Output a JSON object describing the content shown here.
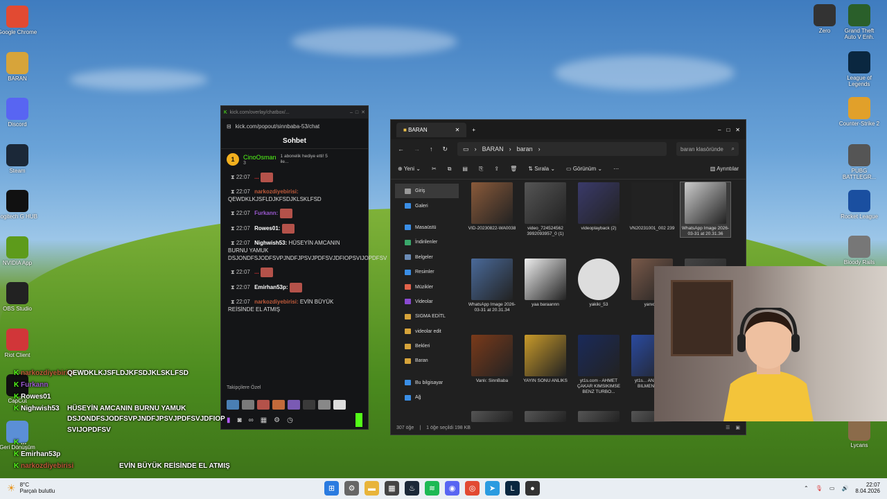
{
  "desktop_left": [
    {
      "name": "google-chrome",
      "label": "Google Chrome",
      "color": "#e24a32"
    },
    {
      "name": "baran-folder",
      "label": "BARAN",
      "color": "#d7a43a"
    },
    {
      "name": "discord",
      "label": "Discord",
      "color": "#5865f2"
    },
    {
      "name": "steam",
      "label": "Steam",
      "color": "#1b2838"
    },
    {
      "name": "logitech-g-hub",
      "label": "Logitech G HUB",
      "color": "#111"
    },
    {
      "name": "nvidia-app",
      "label": "NVIDIA App",
      "color": "#5d9b1b"
    },
    {
      "name": "obs-studio",
      "label": "OBS Studio",
      "color": "#222"
    },
    {
      "name": "riot-client",
      "label": "Riot Client",
      "color": "#d13639"
    },
    {
      "name": "capcut",
      "label": "CapCut",
      "color": "#111"
    },
    {
      "name": "recycle-bin",
      "label": "Geri Dönüşüm",
      "color": "#5b8fd6"
    }
  ],
  "desktop_right": [
    {
      "name": "zero",
      "label": "Zero",
      "color": "#333"
    },
    {
      "name": "gta",
      "label": "Grand Theft Auto V Enh.",
      "color": "#2a5f2a"
    },
    {
      "name": "league",
      "label": "League of Legends",
      "color": "#0a2740"
    },
    {
      "name": "counter-strike",
      "label": "Counter-Strike 2",
      "color": "#e1a02a"
    },
    {
      "name": "pubg",
      "label": "PUBG BATTLEGR...",
      "color": "#555"
    },
    {
      "name": "rocket-league",
      "label": "Rocket League",
      "color": "#1a4fa0"
    },
    {
      "name": "blackmail",
      "label": "Bloody Rails",
      "color": "#777"
    },
    {
      "name": "user",
      "label": "Lycans",
      "color": "#8b6b4a"
    }
  ],
  "kick": {
    "titlebar": "kick.com/overlay/chatbox/...",
    "url": "kick.com/popout/sinnbaba-53/chat",
    "header": "Sohbet",
    "pinned_user": "CinoOsman",
    "pinned_count": "3",
    "pinned_text": "1 abonelik hediye etti! 5 ile...",
    "messages": [
      {
        "time": "22:07",
        "user": "...",
        "text": ""
      },
      {
        "time": "22:07",
        "user": "narkozdiyebirisi:",
        "text": "QEWDKLKJSFLDJKFSDJKLSKLFSD"
      },
      {
        "time": "22:07",
        "user": "Furkann:",
        "text": ""
      },
      {
        "time": "22:07",
        "user": "Rowes01:",
        "text": ""
      },
      {
        "time": "22:07",
        "user": "Nighwish53:",
        "text": "HÜSEYİN AMCANIN BURNU YAMUK DSJONDFSJODFSVPJNDFJPSVJPDFSVJDFIOPSVIJOPDFSV"
      },
      {
        "time": "22:07",
        "user": "...",
        "text": ""
      },
      {
        "time": "22:07",
        "user": "Emirhan53p:",
        "text": ""
      },
      {
        "time": "22:07",
        "user": "narkozdiyebirisi:",
        "text": "EVİN BÜYÜK REİSİNDE EL ATMIŞ"
      }
    ],
    "footer": "Takipçilere Özel"
  },
  "explorer": {
    "tab": "BARAN",
    "breadcrumb": [
      "BARAN",
      "baran"
    ],
    "search": "baran klasöründe",
    "tools": [
      "Yeni",
      "Sırala",
      "Görünüm",
      "Ayrıntılar"
    ],
    "sidebar": [
      {
        "label": "Giriş",
        "color": "#999"
      },
      {
        "label": "Galeri",
        "color": "#3a8ee6"
      },
      {
        "label": "Masaüstü",
        "color": "#3a8ee6"
      },
      {
        "label": "İndirilenler",
        "color": "#3aa86b"
      },
      {
        "label": "Belgeler",
        "color": "#6b8cb6"
      },
      {
        "label": "Resimler",
        "color": "#3a8ee6"
      },
      {
        "label": "Müzikler",
        "color": "#e1624a"
      },
      {
        "label": "Videolar",
        "color": "#8a4ad1"
      },
      {
        "label": "SIGMA EDİTL",
        "color": "#d7a43a"
      },
      {
        "label": "videolar edit",
        "color": "#d7a43a"
      },
      {
        "label": "Bekleri",
        "color": "#d7a43a"
      },
      {
        "label": "Baran",
        "color": "#d7a43a"
      },
      {
        "label": "Bu bilgisayar",
        "color": "#3a8ee6"
      },
      {
        "label": "Ağ",
        "color": "#3a8ee6"
      }
    ],
    "files": [
      "VID-20230822-WA0038",
      "video_724524562 3992093957_0 (1)",
      "videoplayback (2)",
      "VN20231001_002 239",
      "WhatsApp Image 2026-03-31 at 20.31.36",
      "WhatsApp Image 2026-03-31 at 20.31.34",
      "yaa baraannn",
      "yakiki_53",
      "yanıcı...",
      "",
      "Vanlı: SinnBaba",
      "YAYIN SONU ANLIKS",
      "yt1s.com - AHMET ÇAKAR KIMSIKIMSE BENZ TURBO...",
      "yt1s... ANANLA... BILMEN... SEI",
      ""
    ],
    "status": "307 öğe",
    "status_sel": "1 öğe seçildi 198 KB"
  },
  "overlay": [
    {
      "user": "narkozdiyebirisi",
      "text": "QEWDKLKJSFLDJKFSDJKLSKLFSD"
    },
    {
      "user": "Furkann",
      "text": ""
    },
    {
      "user": "Rowes01",
      "text": ""
    },
    {
      "user": "Nighwish53",
      "text": "HÜSEYİN AMCANIN BURNU YAMUK"
    },
    {
      "user": "",
      "text": "DSJONDFSJODFSVPJNDFJPSVJPDFSVJDFIOP"
    },
    {
      "user": "",
      "text": "SVIJOPDFSV"
    },
    {
      "user": "...",
      "text": ""
    },
    {
      "user": "Emirhan53p",
      "text": ""
    },
    {
      "user": "narkozdiyebirisi",
      "text": "EVİN BÜYÜK REİSİNDE EL ATMIŞ"
    }
  ],
  "taskbar": {
    "weather_temp": "8°C",
    "weather_desc": "Parçalı bulutlu",
    "time": "22:07",
    "date": "8.04.2026"
  }
}
